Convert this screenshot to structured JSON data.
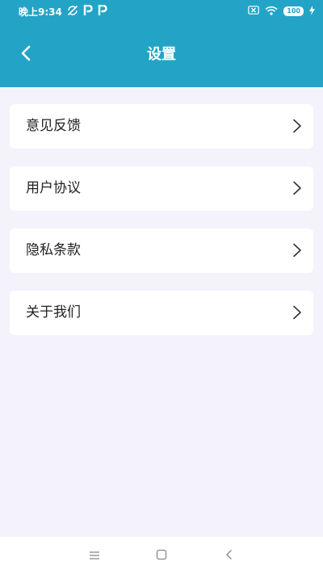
{
  "status_bar": {
    "time": "晚上9:34",
    "battery": "100",
    "icons": [
      "sync-off-icon",
      "p-app-icon",
      "p-app-icon",
      "sim-x-icon",
      "wifi-icon",
      "battery-icon",
      "charging-icon"
    ]
  },
  "header": {
    "title": "设置",
    "back_icon": "chevron-left-icon"
  },
  "menu": {
    "items": [
      {
        "label": "意见反馈",
        "icon": "chevron-right-icon"
      },
      {
        "label": "用户协议",
        "icon": "chevron-right-icon"
      },
      {
        "label": "隐私条款",
        "icon": "chevron-right-icon"
      },
      {
        "label": "关于我们",
        "icon": "chevron-right-icon"
      }
    ]
  },
  "nav_bar": {
    "icons": [
      "menu-icon",
      "home-icon",
      "back-icon"
    ]
  },
  "colors": {
    "header": "#23a4c6",
    "background": "#f4f3fc",
    "card": "#ffffff",
    "text": "#222222"
  }
}
